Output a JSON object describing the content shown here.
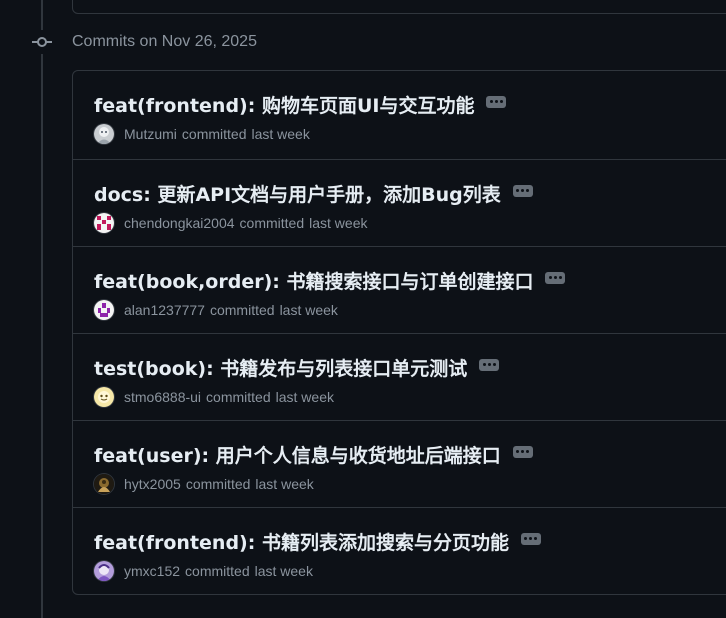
{
  "group": {
    "title": "Commits on Nov 26, 2025"
  },
  "commits": [
    {
      "message": "feat(frontend): 购物车页面UI与交互功能",
      "author": "Mutzumi",
      "verb": "committed",
      "when": "last week"
    },
    {
      "message": "docs: 更新API文档与用户手册，添加Bug列表",
      "author": "chendongkai2004",
      "verb": "committed",
      "when": "last week"
    },
    {
      "message": "feat(book,order): 书籍搜索接口与订单创建接口",
      "author": "alan1237777",
      "verb": "committed",
      "when": "last week"
    },
    {
      "message": "test(book): 书籍发布与列表接口单元测试",
      "author": "stmo6888-ui",
      "verb": "committed",
      "when": "last week"
    },
    {
      "message": "feat(user): 用户个人信息与收货地址后端接口",
      "author": "hytx2005",
      "verb": "committed",
      "when": "last week"
    },
    {
      "message": "feat(frontend): 书籍列表添加搜索与分页功能",
      "author": "ymxc152",
      "verb": "committed",
      "when": "last week"
    }
  ],
  "colors": {
    "background": "#0d1117",
    "border": "#30363d",
    "text_primary": "#e6edf3",
    "text_muted": "#8b949e"
  },
  "icons": {
    "group_node": "git-commit-icon",
    "expand": "kebab-ellipsis-icon"
  }
}
